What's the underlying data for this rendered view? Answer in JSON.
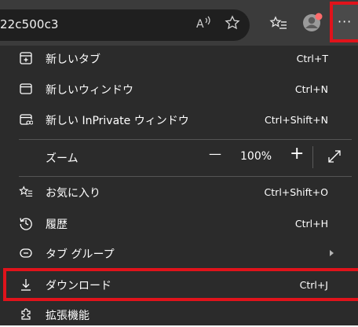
{
  "address_bar": {
    "url_text": "22c500c3",
    "read_aloud_icon": "read-aloud-icon",
    "favorite_icon": "star-outline-icon"
  },
  "toolbar": {
    "favorites_icon": "favorites-list-icon",
    "profile_icon": "profile-avatar-icon",
    "more_label": "···"
  },
  "menu": {
    "items": [
      {
        "label": "新しいタブ",
        "shortcut": "Ctrl+T",
        "icon": "new-tab-icon"
      },
      {
        "label": "新しいウィンドウ",
        "shortcut": "Ctrl+N",
        "icon": "new-window-icon"
      },
      {
        "label": "新しい InPrivate ウィンドウ",
        "shortcut": "Ctrl+Shift+N",
        "icon": "inprivate-window-icon"
      },
      {
        "label": "ズーム",
        "icon": ""
      },
      {
        "label": "お気に入り",
        "shortcut": "Ctrl+Shift+O",
        "icon": "favorites-icon"
      },
      {
        "label": "履歴",
        "shortcut": "Ctrl+H",
        "icon": "history-icon"
      },
      {
        "label": "タブ グループ",
        "icon": "tab-groups-icon"
      },
      {
        "label": "ダウンロード",
        "shortcut": "Ctrl+J",
        "icon": "download-icon"
      },
      {
        "label": "拡張機能",
        "icon": "extensions-icon"
      }
    ],
    "zoom": {
      "value": "100%",
      "minus": "—",
      "plus": "+"
    }
  },
  "colors": {
    "menu_bg": "#2b2b2b",
    "toolbar_bg": "#3b3b3b",
    "highlight": "#e0131b"
  }
}
